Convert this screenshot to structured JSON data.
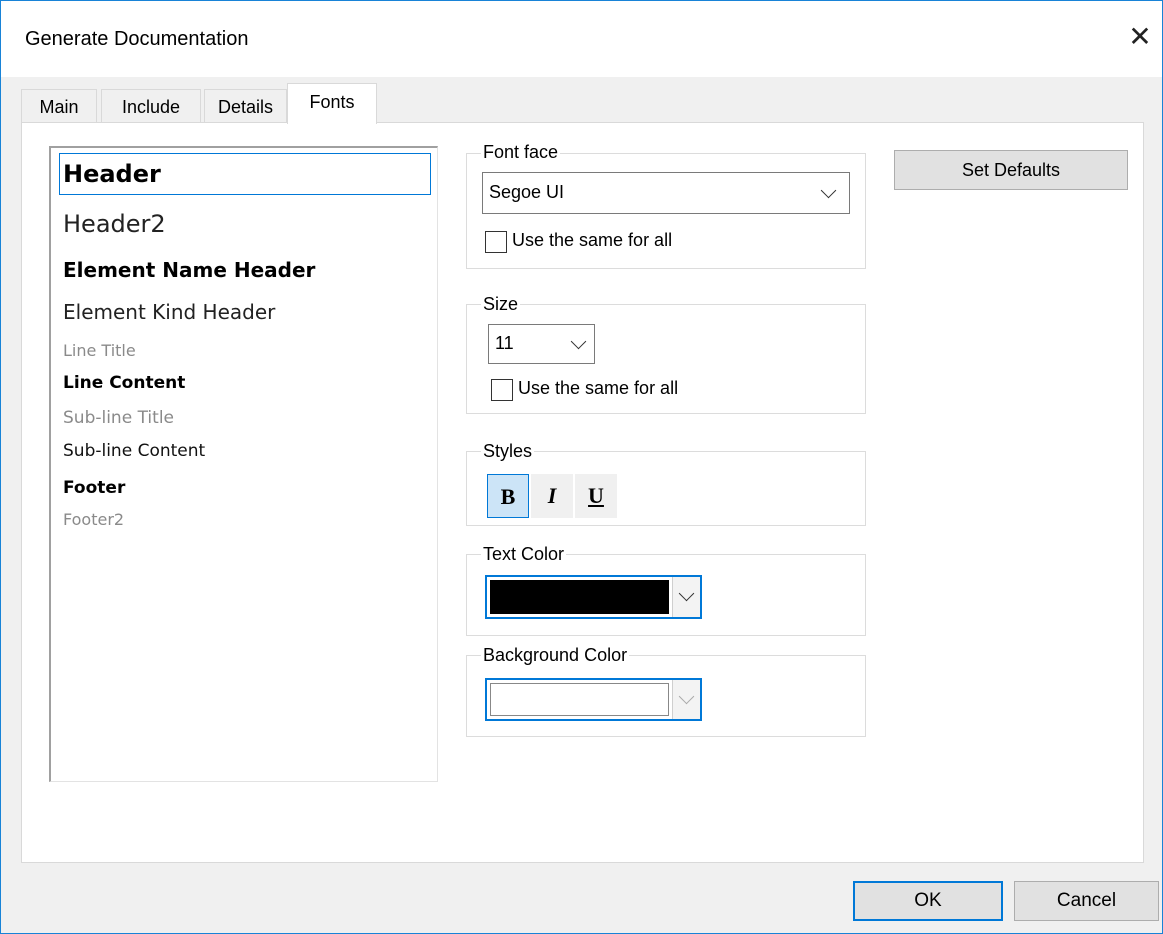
{
  "window": {
    "title": "Generate Documentation"
  },
  "tabs": [
    {
      "label": "Main"
    },
    {
      "label": "Include"
    },
    {
      "label": "Details"
    },
    {
      "label": "Fonts"
    }
  ],
  "font_list": {
    "items": [
      "Header",
      "Header2",
      "Element Name Header",
      "Element Kind Header",
      "Line Title",
      "Line Content",
      "Sub-line Title",
      "Sub-line Content",
      "Footer",
      "Footer2"
    ],
    "selected": "Header"
  },
  "font_face": {
    "label": "Font face",
    "value": "Segoe UI",
    "same_for_all_label": "Use the same for all",
    "same_for_all_checked": false
  },
  "size": {
    "label": "Size",
    "value": "11",
    "same_for_all_label": "Use the same for all",
    "same_for_all_checked": false
  },
  "styles": {
    "label": "Styles",
    "bold": {
      "label": "B",
      "active": true
    },
    "italic": {
      "label": "I",
      "active": false
    },
    "underline": {
      "label": "U",
      "active": false
    }
  },
  "text_color": {
    "label": "Text Color",
    "value": "#000000"
  },
  "background_color": {
    "label": "Background Color",
    "value": "#ffffff"
  },
  "buttons": {
    "set_defaults": "Set Defaults",
    "ok": "OK",
    "cancel": "Cancel"
  },
  "colors": {
    "accent": "#0078d7",
    "window_border": "#1883d7"
  }
}
